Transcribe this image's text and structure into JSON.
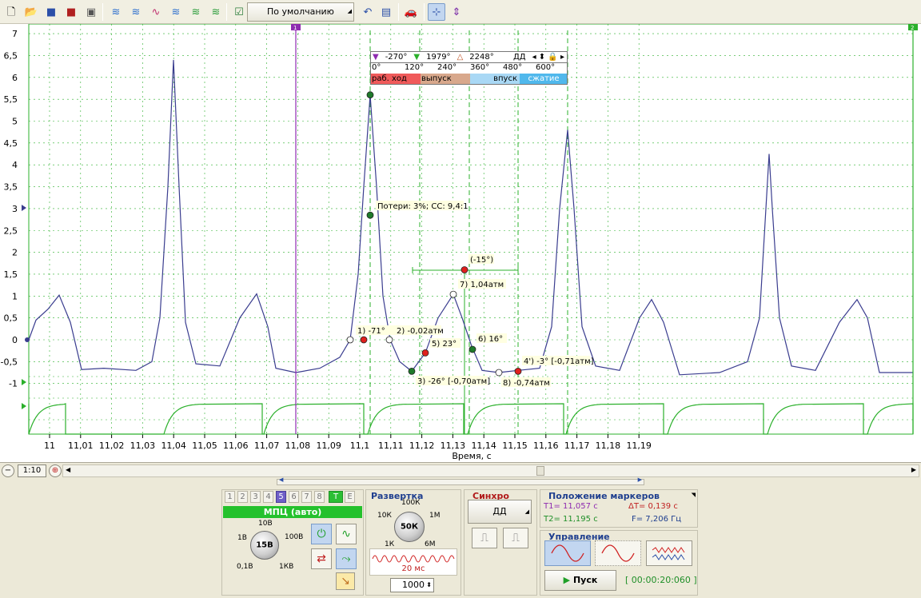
{
  "toolbar": {
    "preset": "По умолчанию",
    "icons": [
      "new-file-icon",
      "open-folder-icon",
      "save-icon",
      "save-as-icon",
      "print-icon",
      "wave-1-icon",
      "wave-2-icon",
      "wave-3-icon",
      "wave-4-icon",
      "wave-5-icon",
      "check-list-icon",
      "undo-icon",
      "save-view-icon",
      "car-icon",
      "cursor-sync-icon",
      "fit-icon"
    ]
  },
  "plot": {
    "y_ticks": [
      "7",
      "6,5",
      "6",
      "5,5",
      "5",
      "4,5",
      "4",
      "3,5",
      "3",
      "2,5",
      "2",
      "1,5",
      "1",
      "0,5",
      "0",
      "-0,5",
      "-1"
    ],
    "x_ticks": [
      "11",
      "11,01",
      "11,02",
      "11,03",
      "11,04",
      "11,05",
      "11,06",
      "11,07",
      "11,08",
      "11,09",
      "11,1",
      "11,11",
      "11,12",
      "11,13",
      "11,14",
      "11,15",
      "11,16",
      "11,17",
      "11,18",
      "11,19"
    ],
    "x_label": "Время, с",
    "marker1_label": "1",
    "marker2_label": "2",
    "annotations": {
      "losses": "Потери: 3%; СС: 9,4:1",
      "p1": "1)  -71°",
      "p2": "2)  -0,02атм",
      "p3": "3)  -26° [-0,70атм]",
      "p4": "4')  -3° [-0,71атм]",
      "p5": "5)  23°",
      "p6": "6)  16°",
      "p7": "7)  1,04атм",
      "p8": "8)  -0,74атм",
      "p_15": "(-15°)"
    },
    "colors": {
      "signal": "#3a3d8f",
      "sync": "#2bb02b",
      "marker1": "#8e2bb0",
      "grid": "#2bb02b",
      "red_point": "#e0201e",
      "green_point": "#1e7a2a"
    }
  },
  "angle_widget": {
    "a1": "-270°",
    "a2": "1979°",
    "a3": "2248°",
    "mode": "ДД",
    "ticks": [
      "0°",
      "120°",
      "240°",
      "360°",
      "480°",
      "600°"
    ],
    "phases": [
      {
        "label": "раб. ход",
        "color": "#f05a5a"
      },
      {
        "label": "выпуск",
        "color": "#d8a88c"
      },
      {
        "label": "впуск",
        "color": "#a9d8f5"
      },
      {
        "label": "сжатие",
        "color": "#50b8ec"
      }
    ]
  },
  "scroll": {
    "zoom": "1:10"
  },
  "channels": {
    "tabs": [
      "1",
      "2",
      "3",
      "4",
      "5",
      "6",
      "7",
      "8",
      "T",
      "E"
    ],
    "selected": "5",
    "mode": "МПЦ (авто)",
    "knob_value": "15В",
    "knob_labels": [
      "10В",
      "1В",
      "100В",
      "0,1В",
      "1КВ"
    ]
  },
  "sweep": {
    "title": "Развертка",
    "knob_value": "50К",
    "knob_labels": [
      "100К",
      "10К",
      "1М",
      "1К",
      "6М"
    ],
    "time": "20 мс",
    "points": "1000"
  },
  "sync": {
    "title": "Синхро",
    "mode": "ДД"
  },
  "markers": {
    "title": "Положение маркеров",
    "t1": "T1= 11,057 с",
    "t2": "T2= 11,195 с",
    "dt": "ΔT= 0,139 с",
    "f": "F= 7,206 Гц"
  },
  "control": {
    "title": "Управление",
    "start": "Пуск",
    "elapsed": "[ 00:00:20:060 ]"
  }
}
